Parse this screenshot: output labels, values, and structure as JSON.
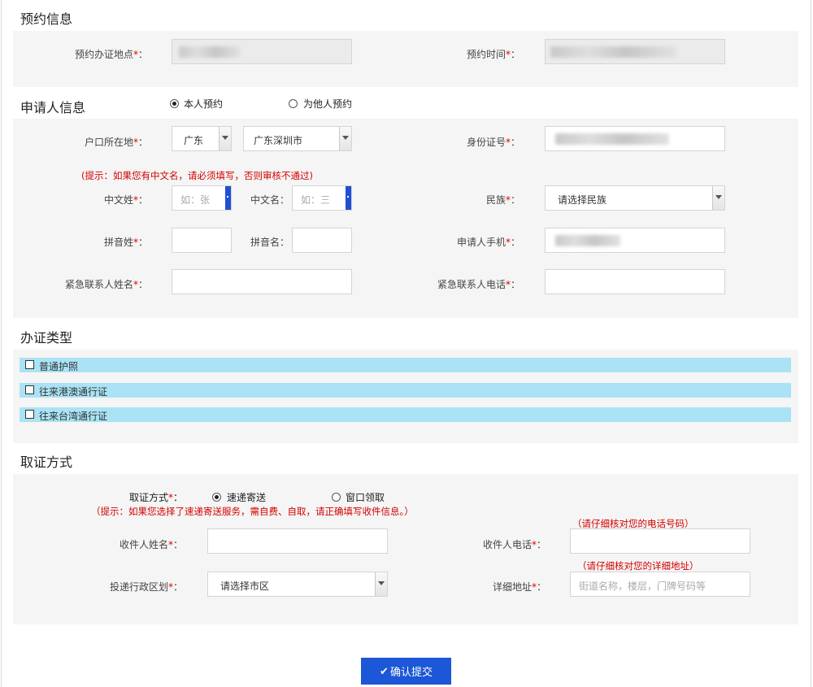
{
  "sections": {
    "appointment": "预约信息",
    "applicant": "申请人信息",
    "doc_type": "办证类型",
    "pickup": "取证方式"
  },
  "appointment": {
    "location_label": "预约办证地点",
    "time_label": "预约时间"
  },
  "applicant": {
    "radio_self": "本人预约",
    "radio_other": "为他人预约",
    "hukou_label": "户口所在地",
    "province_value": "广东",
    "city_value": "广东深圳市",
    "id_label": "身份证号",
    "hint": "(提示：如果您有中文名，请必须填写，否则审核不通过)",
    "cn_surname_label": "中文姓",
    "cn_surname_placeholder": "如：张",
    "cn_name_label": "中文名",
    "cn_name_placeholder": "如：三",
    "ethnic_label": "民族",
    "ethnic_value": "请选择民族",
    "py_surname_label": "拼音姓",
    "py_name_label": "拼音名",
    "phone_label": "申请人手机",
    "emergency_name_label": "紧急联系人姓名",
    "emergency_phone_label": "紧急联系人电话"
  },
  "doc_types": [
    "普通护照",
    "往来港澳通行证",
    "往来台湾通行证"
  ],
  "pickup": {
    "method_label": "取证方式",
    "radio_express": "速递寄送",
    "radio_window": "窗口领取",
    "hint": "（提示：如果您选择了速递寄送服务，需自费、自取，请正确填写收件信息。）",
    "recipient_name_label": "收件人姓名",
    "recipient_phone_label": "收件人电话",
    "phone_hint": "（请仔细核对您的电话号码）",
    "district_label": "投递行政区划",
    "district_value": "请选择市区",
    "address_label": "详细地址",
    "address_hint": "（请仔细核对您的详细地址）",
    "address_placeholder": "街道名称，楼层，门牌号码等"
  },
  "submit_label": "确认提交",
  "required_mark": "*",
  "colon": "："
}
